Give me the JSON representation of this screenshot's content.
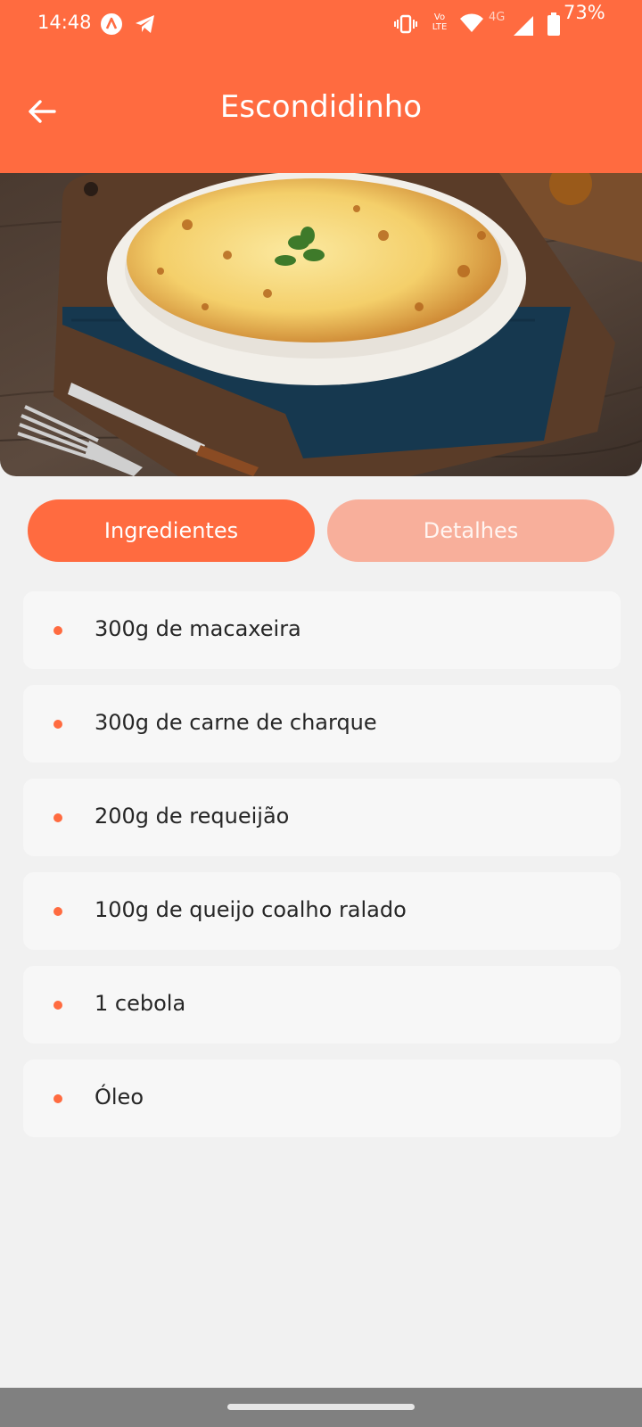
{
  "status_bar": {
    "time": "14:48",
    "battery_percent": "73%",
    "network_label": "4G",
    "volte_label": "Vo LTE",
    "icons": [
      "app-icon",
      "telegram-icon",
      "vibrate-icon",
      "volte-icon",
      "wifi-icon",
      "signal-icon",
      "battery-icon"
    ]
  },
  "header": {
    "title": "Escondidinho",
    "back_icon": "arrow-left-icon",
    "background_color": "#ff6b40"
  },
  "tabs": [
    {
      "label": "Ingredientes",
      "active": true
    },
    {
      "label": "Detalhes",
      "active": false
    }
  ],
  "ingredients": [
    "300g de macaxeira",
    "300g de carne de charque",
    "200g de requeijão",
    "100g de queijo coalho ralado",
    "1 cebola",
    "Óleo"
  ],
  "colors": {
    "accent": "#ff6b40",
    "inactive_tab": "#f8af9b",
    "page_bg": "#f1f1f1",
    "card_bg": "#f7f7f7"
  }
}
